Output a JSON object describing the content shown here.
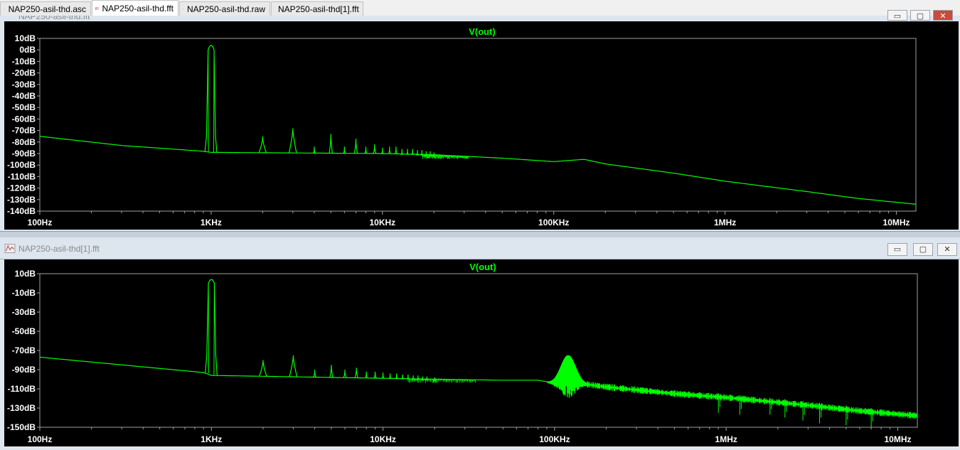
{
  "tabs": [
    {
      "label": "NAP250-asil-thd.asc",
      "icon": "schematic-icon"
    },
    {
      "label": "NAP250-asil-thd.fft",
      "icon": "waveform-icon"
    },
    {
      "label": "NAP250-asil-thd.raw",
      "icon": "waveform-icon"
    },
    {
      "label": "NAP250-asil-thd[1].fft",
      "icon": "waveform-icon"
    }
  ],
  "top_window": {
    "title": "NAP250-asil-thd.fft"
  },
  "bottom_window": {
    "title": "NAP250-asil-thd[1].fft"
  },
  "window_buttons": {
    "minimize": "▭",
    "restore": "▢",
    "close": "✕"
  },
  "colors": {
    "trace": "#00ff00",
    "axis_text": "#ffffff",
    "plot_bg": "#000000",
    "title": "#00ff00"
  },
  "chart_data": [
    {
      "type": "line",
      "title": "V(out)",
      "xscale": "log",
      "xlim": [
        100,
        13000000
      ],
      "ylim": [
        -140,
        10
      ],
      "grid": false,
      "yticks": [
        10,
        0,
        -10,
        -20,
        -30,
        -40,
        -50,
        -60,
        -70,
        -80,
        -90,
        -100,
        -110,
        -120,
        -130,
        -140
      ],
      "yticklabels": [
        "10dB",
        "0dB",
        "-10dB",
        "-20dB",
        "-30dB",
        "-40dB",
        "-50dB",
        "-60dB",
        "-70dB",
        "-80dB",
        "-90dB",
        "-100dB",
        "-110dB",
        "-120dB",
        "-130dB",
        "-140dB"
      ],
      "xticks": [
        100,
        1000,
        10000,
        100000,
        1000000,
        10000000
      ],
      "xticklabels": [
        "100Hz",
        "1KHz",
        "10KHz",
        "100KHz",
        "1MHz",
        "10MHz"
      ],
      "series": [
        {
          "floor": [
            [
              100,
              -75
            ],
            [
              300,
              -83
            ],
            [
              900,
              -88
            ],
            [
              1000,
              -89
            ],
            [
              10000,
              -90
            ],
            [
              20000,
              -91
            ],
            [
              50000,
              -94
            ],
            [
              100000,
              -97
            ],
            [
              150000,
              -95
            ],
            [
              200000,
              -99
            ],
            [
              500000,
              -107
            ],
            [
              1000000,
              -114
            ],
            [
              3000000,
              -123
            ],
            [
              6000000,
              -129
            ],
            [
              13000000,
              -134
            ]
          ],
          "fundamental": {
            "x": 1000,
            "y": 5
          },
          "harmonics": [
            [
              2000,
              -75
            ],
            [
              3000,
              -68
            ],
            [
              4000,
              -84
            ],
            [
              5000,
              -73
            ],
            [
              6000,
              -84
            ],
            [
              7000,
              -77
            ],
            [
              8000,
              -84
            ],
            [
              9000,
              -82
            ],
            [
              10000,
              -85
            ],
            [
              11000,
              -84
            ],
            [
              12000,
              -84
            ],
            [
              13000,
              -86
            ],
            [
              14000,
              -86
            ],
            [
              15000,
              -86
            ],
            [
              16000,
              -87
            ],
            [
              17000,
              -87
            ],
            [
              18000,
              -88
            ],
            [
              19000,
              -88
            ],
            [
              20000,
              -89
            ]
          ],
          "noise_region": [
            17000,
            32000
          ],
          "noise_dip": -95
        }
      ]
    },
    {
      "type": "line",
      "title": "V(out)",
      "xscale": "log",
      "xlim": [
        100,
        13000000
      ],
      "ylim": [
        -150,
        10
      ],
      "grid": false,
      "yticks": [
        10,
        -10,
        -30,
        -50,
        -70,
        -90,
        -110,
        -130,
        -150
      ],
      "yticklabels": [
        "10dB",
        "-10dB",
        "-30dB",
        "-50dB",
        "-70dB",
        "-90dB",
        "-110dB",
        "-130dB",
        "-150dB"
      ],
      "xticks": [
        100,
        1000,
        10000,
        100000,
        1000000,
        10000000
      ],
      "xticklabels": [
        "100Hz",
        "1KHz",
        "10KHz",
        "100KHz",
        "1MHz",
        "10MHz"
      ],
      "series": [
        {
          "floor": [
            [
              100,
              -77
            ],
            [
              300,
              -85
            ],
            [
              900,
              -93
            ],
            [
              1000,
              -96
            ],
            [
              10000,
              -99
            ],
            [
              50000,
              -101
            ],
            [
              80000,
              -101
            ],
            [
              100000,
              -104
            ],
            [
              150000,
              -105
            ],
            [
              200000,
              -108
            ],
            [
              500000,
              -115
            ],
            [
              1000000,
              -119
            ],
            [
              3000000,
              -127
            ],
            [
              6000000,
              -133
            ],
            [
              13000000,
              -138
            ]
          ],
          "fundamental": {
            "x": 1000,
            "y": 5
          },
          "harmonics": [
            [
              2000,
              -80
            ],
            [
              3000,
              -75
            ],
            [
              4000,
              -90
            ],
            [
              5000,
              -85
            ],
            [
              6000,
              -90
            ],
            [
              7000,
              -88
            ],
            [
              8000,
              -92
            ],
            [
              9000,
              -92
            ],
            [
              10000,
              -93
            ],
            [
              11000,
              -94
            ],
            [
              12000,
              -94
            ],
            [
              13000,
              -95
            ],
            [
              14000,
              -95
            ],
            [
              15000,
              -96
            ],
            [
              16000,
              -96
            ],
            [
              17000,
              -97
            ],
            [
              18000,
              -97
            ],
            [
              20000,
              -98
            ]
          ],
          "hump": {
            "center": 120000,
            "peak": -75
          },
          "noise_region": [
            14000,
            35000
          ],
          "noise_dip": -104,
          "spurs": [
            [
              900000,
              -125
            ],
            [
              1200000,
              -127
            ],
            [
              1800000,
              -127
            ],
            [
              2200000,
              -130
            ],
            [
              2800000,
              -133
            ],
            [
              3500000,
              -136
            ],
            [
              5000000,
              -138
            ],
            [
              7000000,
              -140
            ]
          ]
        }
      ]
    }
  ]
}
